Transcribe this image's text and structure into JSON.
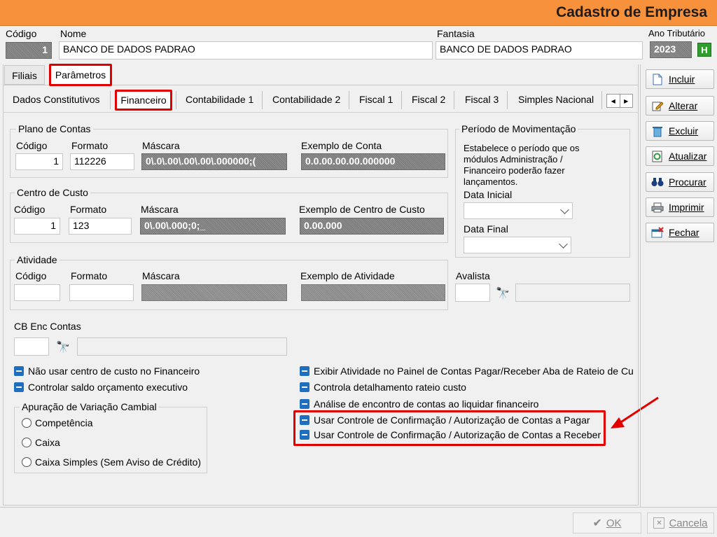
{
  "window": {
    "title": "Cadastro de Empresa"
  },
  "header": {
    "codigo_label": "Código",
    "codigo_value": "1",
    "nome_label": "Nome",
    "nome_value": "BANCO DE DADOS PADRAO",
    "fantasia_label": "Fantasia",
    "fantasia_value": "BANCO DE DADOS PADRAO",
    "ano_label": "Ano Tributário",
    "ano_value": "2023",
    "ano_btn": "H"
  },
  "main_tabs": [
    "Filiais",
    "Parâmetros"
  ],
  "sub_tabs": [
    "Dados Constitutivos",
    "Financeiro",
    "Contabilidade 1",
    "Contabilidade 2",
    "Fiscal 1",
    "Fiscal 2",
    "Fiscal 3",
    "Simples Nacional"
  ],
  "plano": {
    "title": "Plano de Contas",
    "codigo_label": "Código",
    "codigo_value": "1",
    "formato_label": "Formato",
    "formato_value": "112226",
    "mascara_label": "Máscara",
    "mascara_value": "0\\.0\\.00\\.00\\.00\\.000000;(",
    "exemplo_label": "Exemplo de Conta",
    "exemplo_value": "0.0.00.00.00.000000"
  },
  "centro": {
    "title": "Centro de Custo",
    "codigo_label": "Código",
    "codigo_value": "1",
    "formato_label": "Formato",
    "formato_value": "123",
    "mascara_label": "Máscara",
    "mascara_value": "0\\.00\\.000;0;_",
    "exemplo_label": "Exemplo de Centro de Custo",
    "exemplo_value": "0.00.000"
  },
  "atividade": {
    "title": "Atividade",
    "codigo_label": "Código",
    "formato_label": "Formato",
    "mascara_label": "Máscara",
    "exemplo_label": "Exemplo de Atividade"
  },
  "periodo": {
    "title": "Período de Movimentação",
    "desc": "Estabelece o período que os módulos Administração / Financeiro poderão fazer lançamentos.",
    "data_inicial_label": "Data Inicial",
    "data_final_label": "Data Final"
  },
  "avalista_label": "Avalista",
  "cb_label": "CB Enc Contas",
  "options_left": [
    "Não usar centro de custo no Financeiro",
    "Controlar saldo orçamento executivo"
  ],
  "options_right": [
    "Exibir Atividade no Painel de Contas Pagar/Receber Aba de Rateio de Cu",
    "Controla detalhamento rateio custo",
    "Análise de encontro de contas ao liquidar financeiro",
    "Usar Controle de Confirmação / Autorização de Contas a Pagar",
    "Usar Controle de Confirmação / Autorização de Contas a Receber"
  ],
  "cambial": {
    "title": "Apuração de Variação Cambial",
    "options": [
      "Competência",
      "Caixa",
      "Caixa Simples (Sem Aviso de Crédito)"
    ]
  },
  "side_buttons": [
    "Incluir",
    "Alterar",
    "Excluir",
    "Atualizar",
    "Procurar",
    "Imprimir",
    "Fechar"
  ],
  "footer": {
    "ok": "OK",
    "cancel": "Cancela"
  },
  "colors": {
    "titlebar": "#f7913c",
    "highlight": "#e00000",
    "checkbox": "#1f6fc1"
  }
}
